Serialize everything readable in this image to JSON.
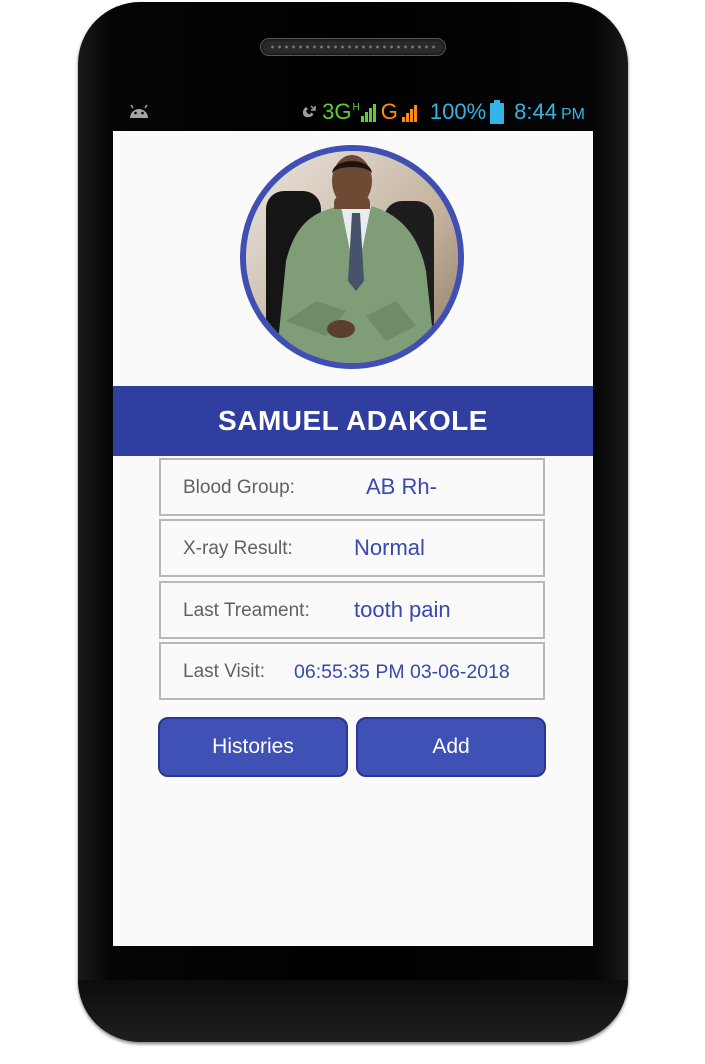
{
  "status_bar": {
    "network_3g": "3G",
    "network_h": "H",
    "network_g": "G",
    "battery": "100%",
    "time": "8:44",
    "ampm": "PM",
    "icons": [
      "android-icon",
      "missed-call-icon",
      "signal-icon",
      "battery-icon"
    ],
    "colors": {
      "text": "#33b5e5",
      "net3g": "#5fcf2b",
      "netg": "#ff8a1a"
    }
  },
  "profile": {
    "name": "SAMUEL ADAKOLE",
    "avatar_icon": "profile-photo"
  },
  "info": [
    {
      "label": "Blood Group:",
      "value": "AB Rh-"
    },
    {
      "label": "X-ray Result:",
      "value": "Normal"
    },
    {
      "label": "Last Treament:",
      "value": "tooth pain"
    },
    {
      "label": "Last Visit:",
      "value": "06:55:35 PM 03-06-2018"
    }
  ],
  "buttons": {
    "histories": "Histories",
    "add": "Add"
  },
  "colors": {
    "accent": "#303f9f",
    "button": "#3f51b5",
    "value_text": "#3949ab",
    "label_text": "#616161"
  }
}
